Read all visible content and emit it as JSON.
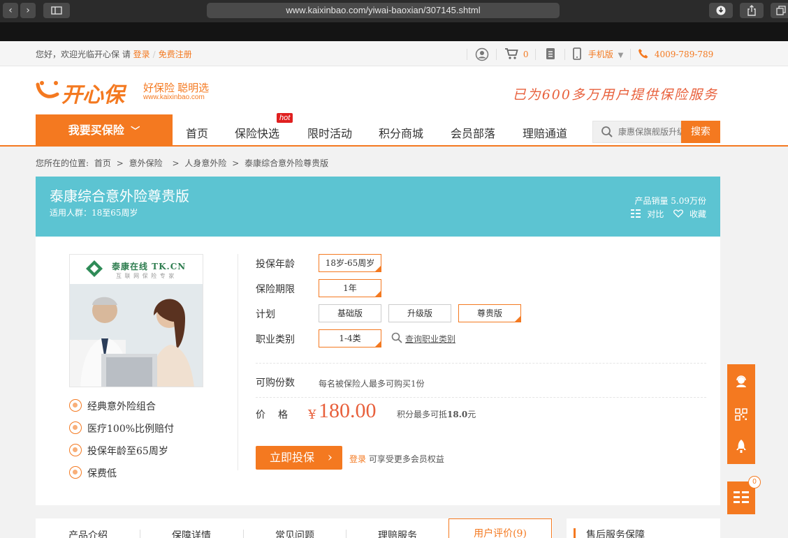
{
  "browser": {
    "url": "www.kaixinbao.com/yiwai-baoxian/307145.shtml",
    "back_icon": "chevron-left-icon",
    "forward_icon": "chevron-right-icon"
  },
  "topbar": {
    "welcome": "您好，欢迎光临开心保 请",
    "login": "登录",
    "sep": "/",
    "register": "免费注册",
    "cart_count": "0",
    "mobile": "手机版",
    "phone": "4009-789-789"
  },
  "header": {
    "logo_text": "开心保",
    "logo_slogan": "好保险 聪明选",
    "logo_url": "www.kaixinbao.com",
    "slogan": "已为600多万用户提供保险服务",
    "buy_button": "我要买保险",
    "nav": [
      "首页",
      "保险快选",
      "限时活动",
      "积分商城",
      "会员部落",
      "理赔通道"
    ],
    "hot_badge": "hot",
    "search_placeholder": "康惠保旗舰版升级",
    "search_button": "搜索"
  },
  "breadcrumb": {
    "prefix": "您所在的位置:",
    "items": [
      "首页",
      "意外保险",
      "人身意外险",
      "泰康综合意外险尊贵版"
    ],
    "sep": ">"
  },
  "product": {
    "title": "泰康综合意外险尊贵版",
    "audience": "适用人群：18至65周岁",
    "sales": "产品销量 5.09万份",
    "compare": "对比",
    "favorite": "收藏",
    "image_logo": "泰康在线 TK.CN",
    "image_logo_sub": "互 联 网 保 险 专 家",
    "features": [
      "经典意外险组合",
      "医疗100%比例赔付",
      "投保年龄至65周岁",
      "保费低"
    ]
  },
  "options": {
    "age_label": "投保年龄",
    "age_value": "18岁-65周岁",
    "period_label": "保险期限",
    "period_value": "1年",
    "plan_label": "计划",
    "plans": [
      "基础版",
      "升级版",
      "尊贵版"
    ],
    "occupation_label": "职业类别",
    "occupation_value": "1-4类",
    "occupation_link": "查询职业类别",
    "quantity_label": "可购份数",
    "quantity_value": "每名被保险人最多可购买1份",
    "price_label": "价　格",
    "price_symbol": "¥",
    "price": "180.00",
    "points_prefix": "积分最多可抵",
    "points_amount": "18.0",
    "points_suffix": "元",
    "buy_now": "立即投保",
    "login": "登录",
    "login_note": "可享受更多会员权益"
  },
  "tabs": [
    "产品介绍",
    "保障详情",
    "常见问题",
    "理赔服务",
    "用户评价(9)"
  ],
  "after_sale": "售后服务保障",
  "side": {
    "compare_count": "0"
  },
  "colors": {
    "accent": "#f47920",
    "banner": "#5cc4d2",
    "price": "#e8603c"
  }
}
